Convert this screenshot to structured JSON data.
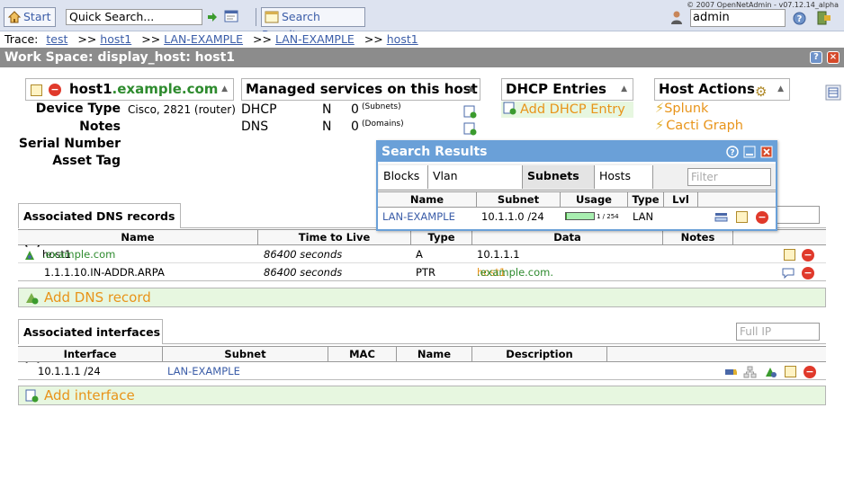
{
  "copyright": "© 2007 OpenNetAdmin - v07.12.14_alpha",
  "toolbar": {
    "start": "Start",
    "quick_search_value": "Quick Search...",
    "search_results": "Search Results",
    "user": "admin"
  },
  "trace": {
    "label": "Trace:",
    "items": [
      "test",
      "host1",
      "LAN-EXAMPLE",
      "LAN-EXAMPLE",
      "host1"
    ],
    "sep": ">>"
  },
  "workspace": {
    "title": "Work Space: display_host: host1"
  },
  "host": {
    "name_prefix": "host1",
    "name_domain": ".example.com",
    "labels": {
      "device_type": "Device Type",
      "notes": "Notes",
      "serial": "Serial Number",
      "asset": "Asset Tag"
    },
    "device_type": "Cisco, 2821 (router)"
  },
  "services": {
    "title": "Managed services on this host",
    "rows": [
      {
        "name": "DHCP",
        "flag": "N",
        "count": "0",
        "unit": "(Subnets)"
      },
      {
        "name": "DNS",
        "flag": "N",
        "count": "0",
        "unit": "(Domains)"
      }
    ]
  },
  "dhcp": {
    "title": "DHCP Entries",
    "add": "Add DHCP Entry"
  },
  "actions": {
    "title": "Host Actions",
    "items": [
      "Splunk",
      "Cacti Graph"
    ]
  },
  "search_results": {
    "title": "Search Results",
    "tabs": [
      "Blocks",
      "Vlan campuses",
      "Subnets (1)",
      "Hosts (0)"
    ],
    "filter_placeholder": "Filter",
    "columns": [
      "Name",
      "Subnet",
      "Usage",
      "Type",
      "Lvl"
    ],
    "row": {
      "name": "LAN-EXAMPLE",
      "subnet": "10.1.1.0 /24",
      "usage_text": "1 / 254",
      "usage_fraction": 0.004,
      "type": "LAN"
    }
  },
  "dns": {
    "title": "Associated DNS records (2)",
    "columns": [
      "Name",
      "Time to Live",
      "Type",
      "Data",
      "Notes"
    ],
    "rows": [
      {
        "name_prefix": "host1",
        "name_domain": ".example.com",
        "ttl": "86400 seconds",
        "type": "A",
        "data": "10.1.1.1",
        "data_domain": ""
      },
      {
        "name_prefix": "1.1.1.10.IN-ADDR.ARPA",
        "name_domain": "",
        "ttl": "86400 seconds",
        "type": "PTR",
        "data": "host1",
        "data_domain": ".example.com."
      }
    ],
    "add": "Add DNS record"
  },
  "interfaces": {
    "title": "Associated interfaces (1)",
    "filter_placeholder": "Full IP",
    "columns": [
      "Interface",
      "Subnet",
      "MAC",
      "Name",
      "Description"
    ],
    "rows": [
      {
        "interface": "10.1.1.1 /24",
        "subnet": "LAN-EXAMPLE",
        "mac": "",
        "name": "",
        "description": ""
      }
    ],
    "add": "Add interface"
  }
}
